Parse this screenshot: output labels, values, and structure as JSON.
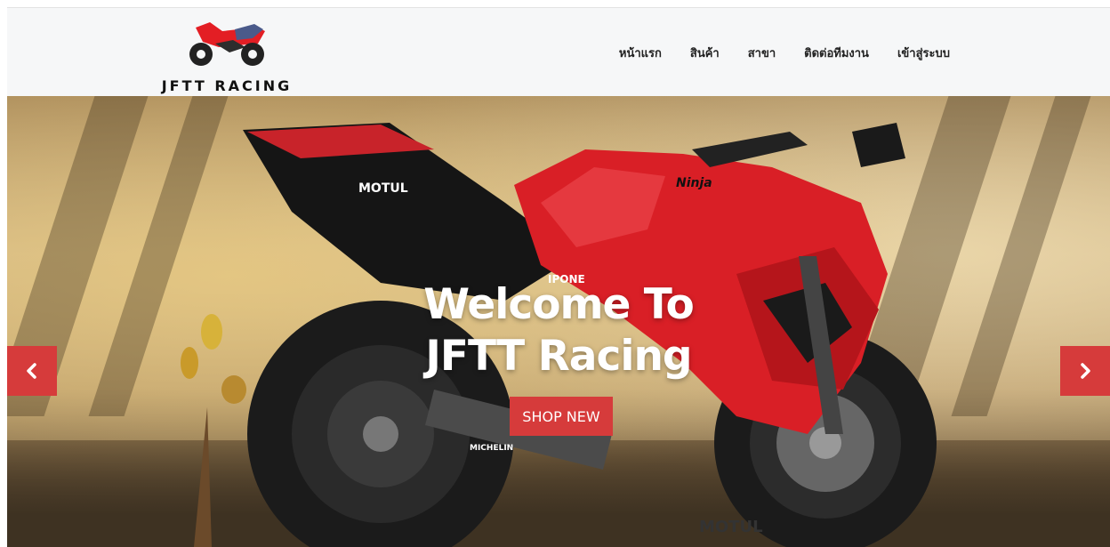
{
  "brand": {
    "name": "JFTT RACING",
    "logo_icon": "motorbike-logo-icon"
  },
  "nav": {
    "items": [
      {
        "label": "หน้าแรก"
      },
      {
        "label": "สินค้า"
      },
      {
        "label": "สาขา"
      },
      {
        "label": "ติดต่อทีมงาน"
      },
      {
        "label": "เข้าสู่ระบบ"
      }
    ]
  },
  "hero": {
    "title_line1": "Welcome To",
    "title_line2": "JFTT Racing",
    "cta_label": "SHOP NEW",
    "prev_icon": "chevron-left-icon",
    "next_icon": "chevron-right-icon",
    "bike_text": [
      "MOTUL",
      "Ninja",
      "MICHELIN",
      "IPONE"
    ]
  },
  "colors": {
    "accent": "#d63b3b",
    "header_bg": "#f6f7f8",
    "nav_text": "#222222"
  }
}
